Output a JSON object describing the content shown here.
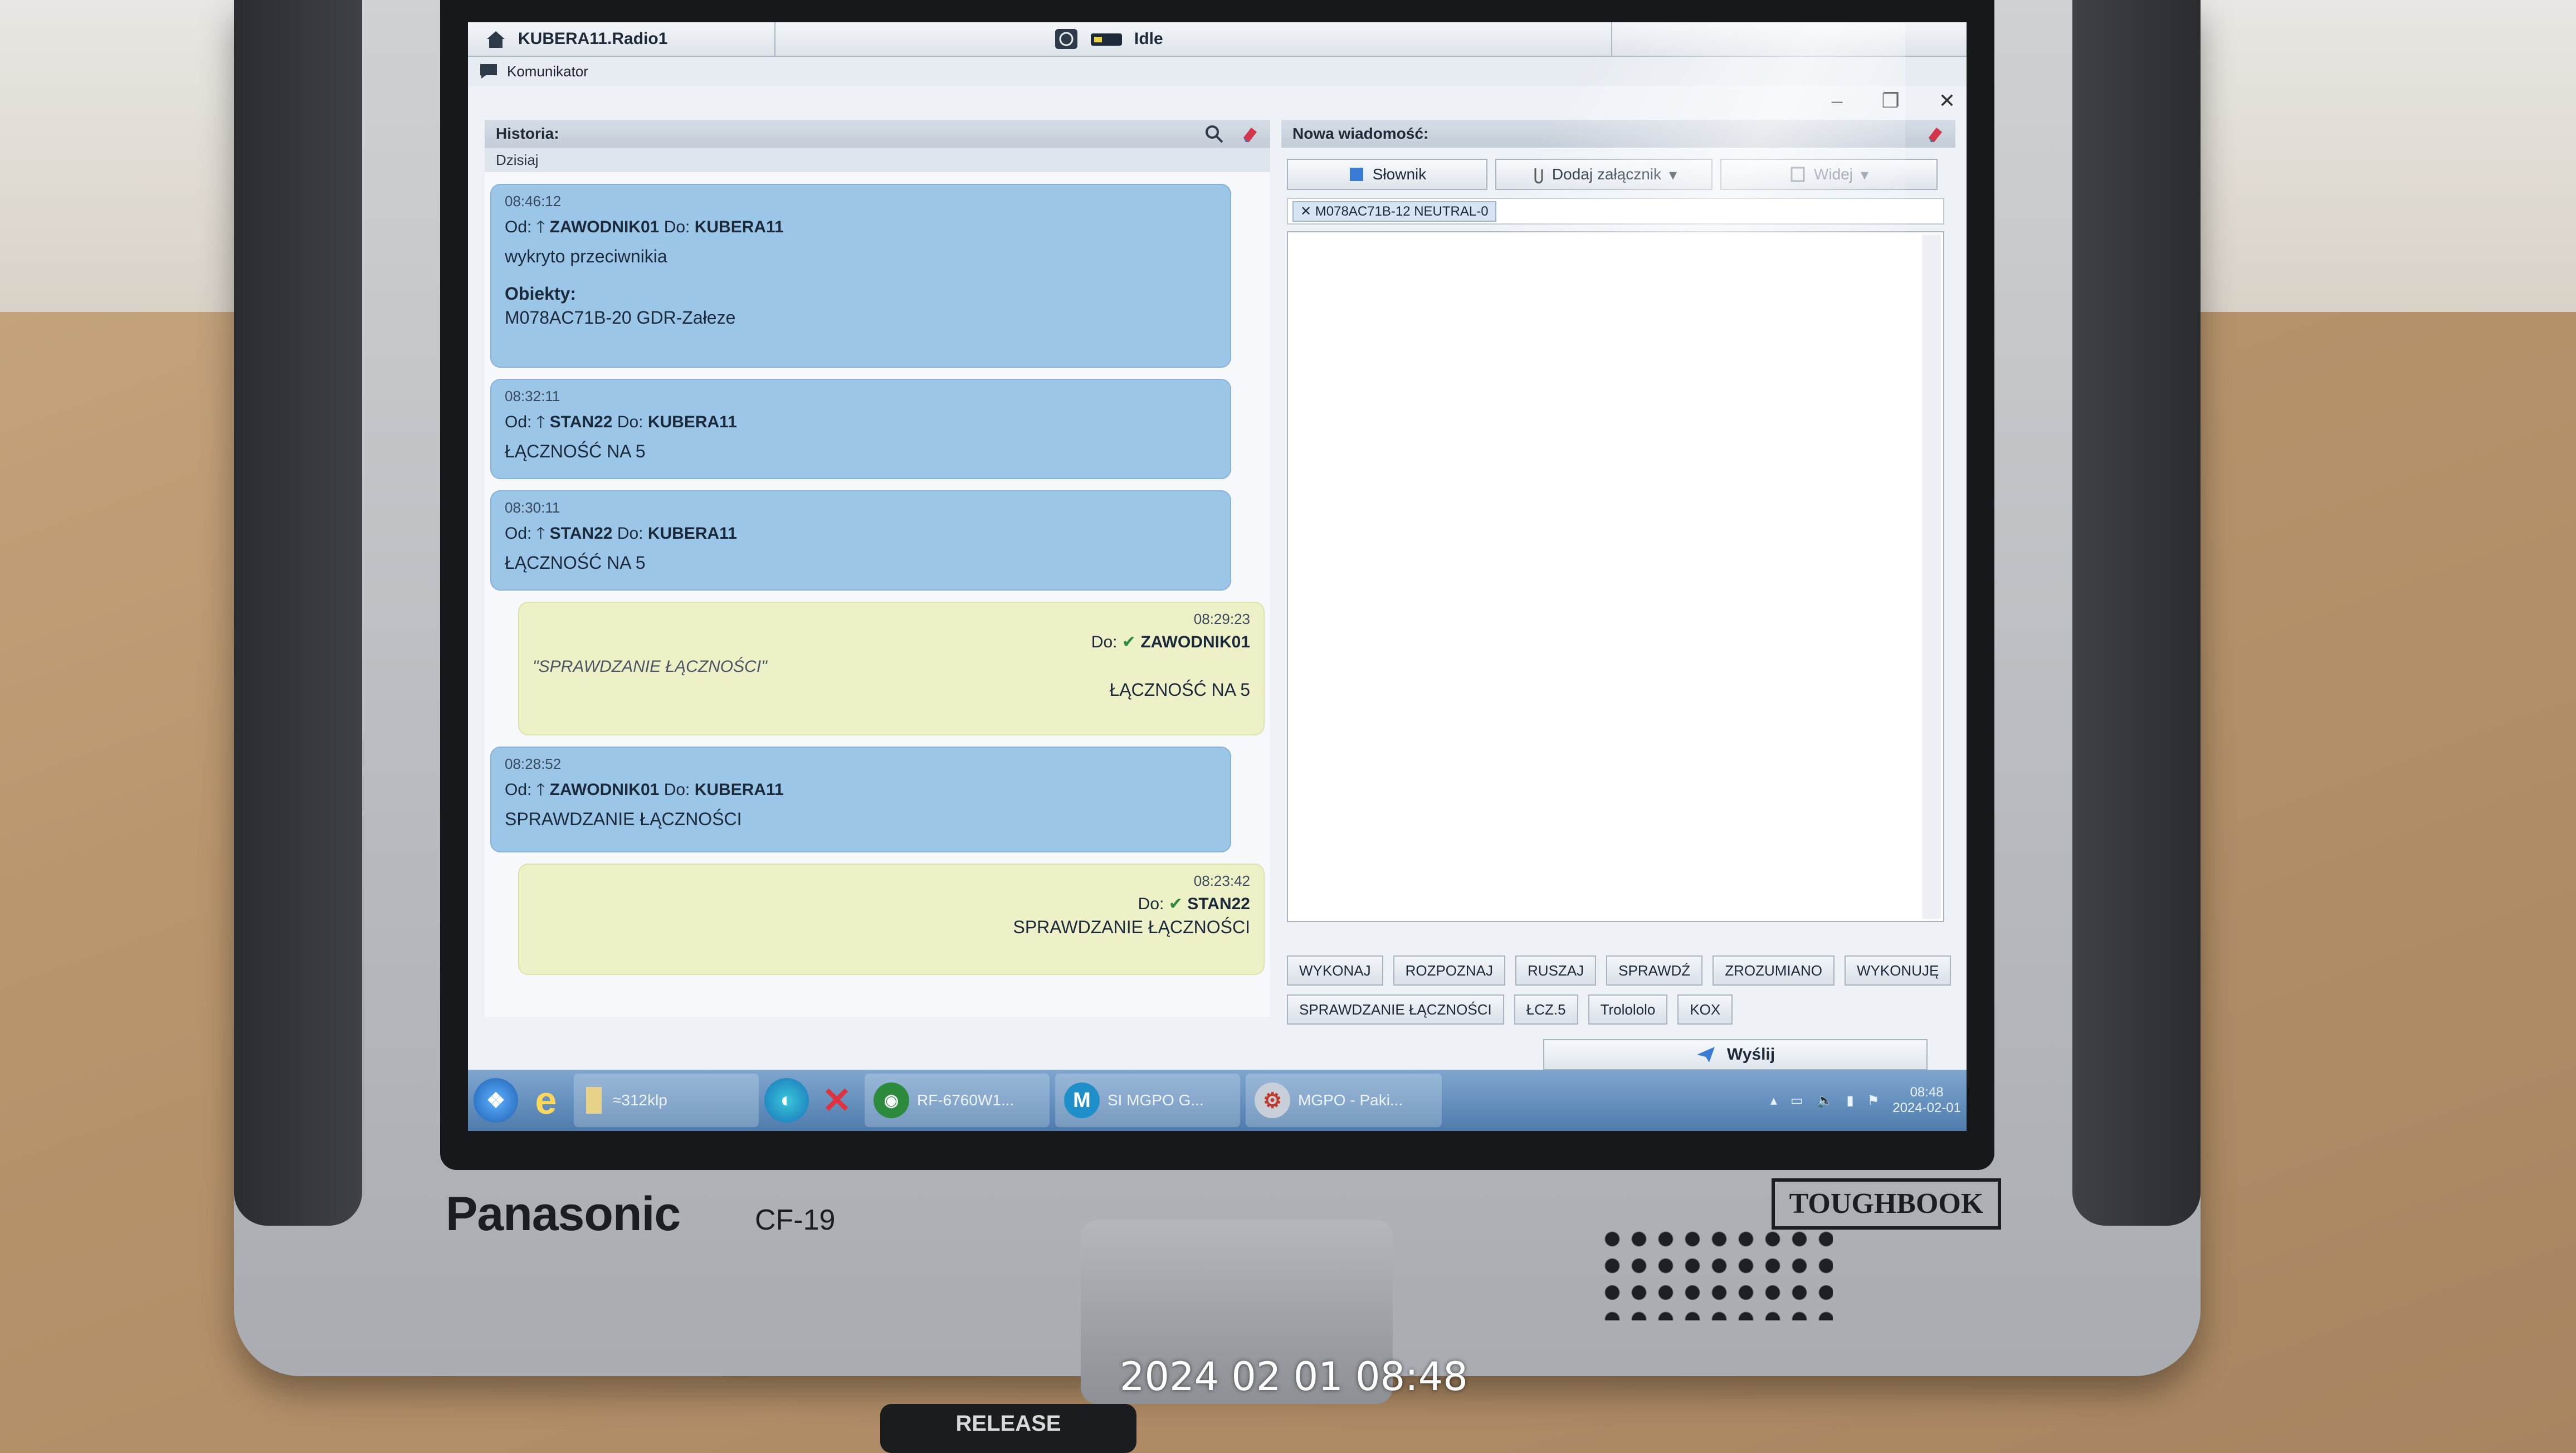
{
  "device": {
    "brand": "Panasonic",
    "model": "CF-19",
    "badge": "TOUGHBOOK",
    "release": "RELEASE"
  },
  "photo_timestamp": "2024 02 01 08:48",
  "topbar": {
    "radio": "KUBERA11.Radio1",
    "status": "Idle"
  },
  "menu": {
    "app": "Komunikator"
  },
  "history": {
    "title": "Historia:",
    "day": "Dzisiaj",
    "messages": [
      {
        "dir": "in",
        "time": "08:46:12",
        "from_label": "Od:",
        "from": "ZAWODNIK01",
        "to_label": "Do:",
        "to": "KUBERA11",
        "body": "wykryto przeciwnikia",
        "objects_label": "Obiekty:",
        "object": "M078AC71B-20 GDR-Załeze"
      },
      {
        "dir": "in",
        "time": "08:32:11",
        "from_label": "Od:",
        "from": "STAN22",
        "to_label": "Do:",
        "to": "KUBERA11",
        "body": "ŁĄCZNOŚĆ NA 5"
      },
      {
        "dir": "in",
        "time": "08:30:11",
        "from_label": "Od:",
        "from": "STAN22",
        "to_label": "Do:",
        "to": "KUBERA11",
        "body": "ŁĄCZNOŚĆ NA 5"
      },
      {
        "dir": "out",
        "time": "08:29:23",
        "to_label": "Do:",
        "to": "ZAWODNIK01",
        "quote": "\"SPRAWDZANIE ŁĄCZNOŚCI\"",
        "body": "ŁĄCZNOŚĆ NA 5"
      },
      {
        "dir": "in",
        "time": "08:28:52",
        "from_label": "Od:",
        "from": "ZAWODNIK01",
        "to_label": "Do:",
        "to": "KUBERA11",
        "body": "SPRAWDZANIE ŁĄCZNOŚCI"
      },
      {
        "dir": "out",
        "time": "08:23:42",
        "to_label": "Do:",
        "to": "STAN22",
        "body": "SPRAWDZANIE ŁĄCZNOŚCI"
      }
    ]
  },
  "compose": {
    "title": "Nowa wiadomość:",
    "dictionary_label": "Słownik",
    "attach_label": "Dodaj załącznik",
    "visibility_label": "Widej",
    "recipient_chip": "M078AC71B-12 NEUTRAL-0",
    "quick_row1": [
      "WYKONAJ",
      "ROZPOZNAJ",
      "RUSZAJ",
      "SPRAWDŹ",
      "ZROZUMIANO",
      "WYKONUJĘ"
    ],
    "quick_row2": [
      "SPRAWDZANIE ŁĄCZNOŚCI",
      "ŁCZ.5",
      "Trolololo",
      "KOX"
    ],
    "send_label": "Wyślij"
  },
  "taskbar": {
    "items": [
      {
        "label": "≈312klp",
        "icon": "folder-icon"
      },
      {
        "label": "RF-6760W1...",
        "icon": "network-icon"
      },
      {
        "label": "SI MGPO G...",
        "icon": "m-app-icon"
      },
      {
        "label": "MGPO - Paki...",
        "icon": "gear-app-icon"
      }
    ],
    "clock_time": "08:48",
    "clock_date": "2024-02-01"
  }
}
